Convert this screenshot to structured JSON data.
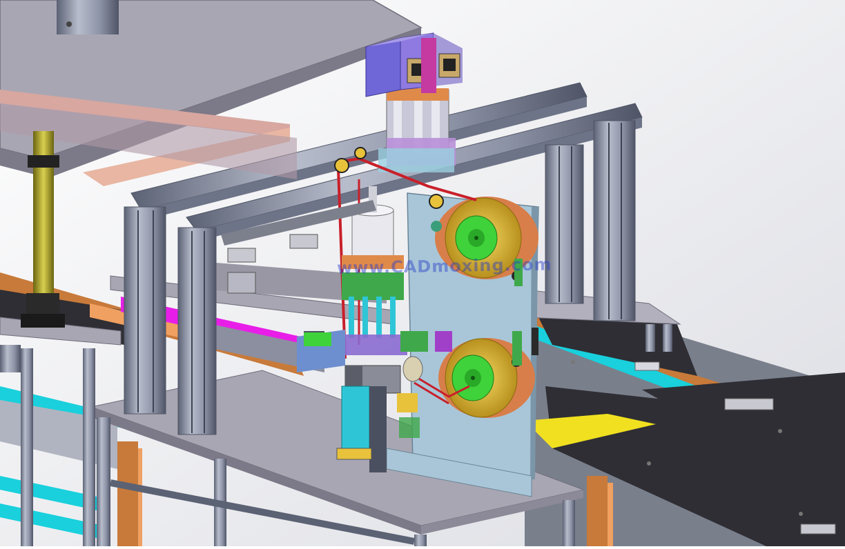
{
  "scene": {
    "kind": "3D CAD assembly render",
    "background": "#f2f2f4",
    "watermark_text": "www.CADmoxing.com"
  },
  "colors": {
    "table_top": "#8f8b99",
    "table_top_light": "#a9a6b3",
    "aluminum_profile": "#9aa0b2",
    "aluminum_dark": "#5b6274",
    "conveyor_plate": "#2e2e34",
    "conveyor_rail_orange": "#c87a3a",
    "conveyor_rail_cyan": "#19d0dc",
    "magenta_bar": "#e81ee8",
    "reel_yellow": "#e8c23a",
    "reel_hub_green": "#3fd23a",
    "mount_plate": "#a8c6d8",
    "belt_red": "#c8202a",
    "camera_purple": "#6f67d8",
    "cylinder_teal": "#2ec6d6",
    "pillar_olive": "#a8a02a",
    "copper_block": "#e08a4a"
  },
  "components": [
    "upper-press-table",
    "aluminum-profile-frame",
    "conveyor-left",
    "conveyor-right",
    "tape-reel-upper",
    "tape-reel-lower",
    "reel-mounting-plate",
    "drive-belt",
    "camera-module",
    "servo-motor",
    "press-cylinder",
    "guide-pillar",
    "lower-base-table"
  ]
}
